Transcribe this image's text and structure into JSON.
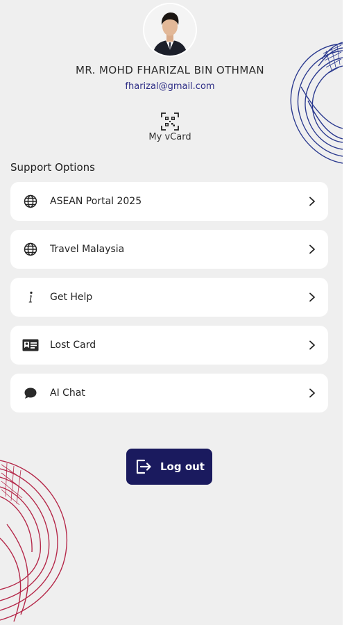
{
  "profile": {
    "name": "MR. MOHD FHARIZAL BIN OTHMAN",
    "email": "fharizal@gmail.com"
  },
  "vcard": {
    "label": "My vCard",
    "icon": "qr-code-icon"
  },
  "support": {
    "title": "Support Options",
    "items": [
      {
        "label": "ASEAN Portal 2025",
        "icon": "globe-icon"
      },
      {
        "label": "Travel Malaysia",
        "icon": "globe-icon"
      },
      {
        "label": "Get Help",
        "icon": "info-icon"
      },
      {
        "label": "Lost Card",
        "icon": "id-card-icon"
      },
      {
        "label": "AI Chat",
        "icon": "chat-bubble-icon"
      }
    ]
  },
  "logout": {
    "label": "Log out",
    "icon": "logout-icon"
  },
  "colors": {
    "background": "#efefef",
    "card": "#ffffff",
    "primary_navy": "#1a1a5e",
    "email_text": "#2e2e86",
    "deco_blue": "#2b3a8f",
    "deco_red": "#b5294a"
  }
}
